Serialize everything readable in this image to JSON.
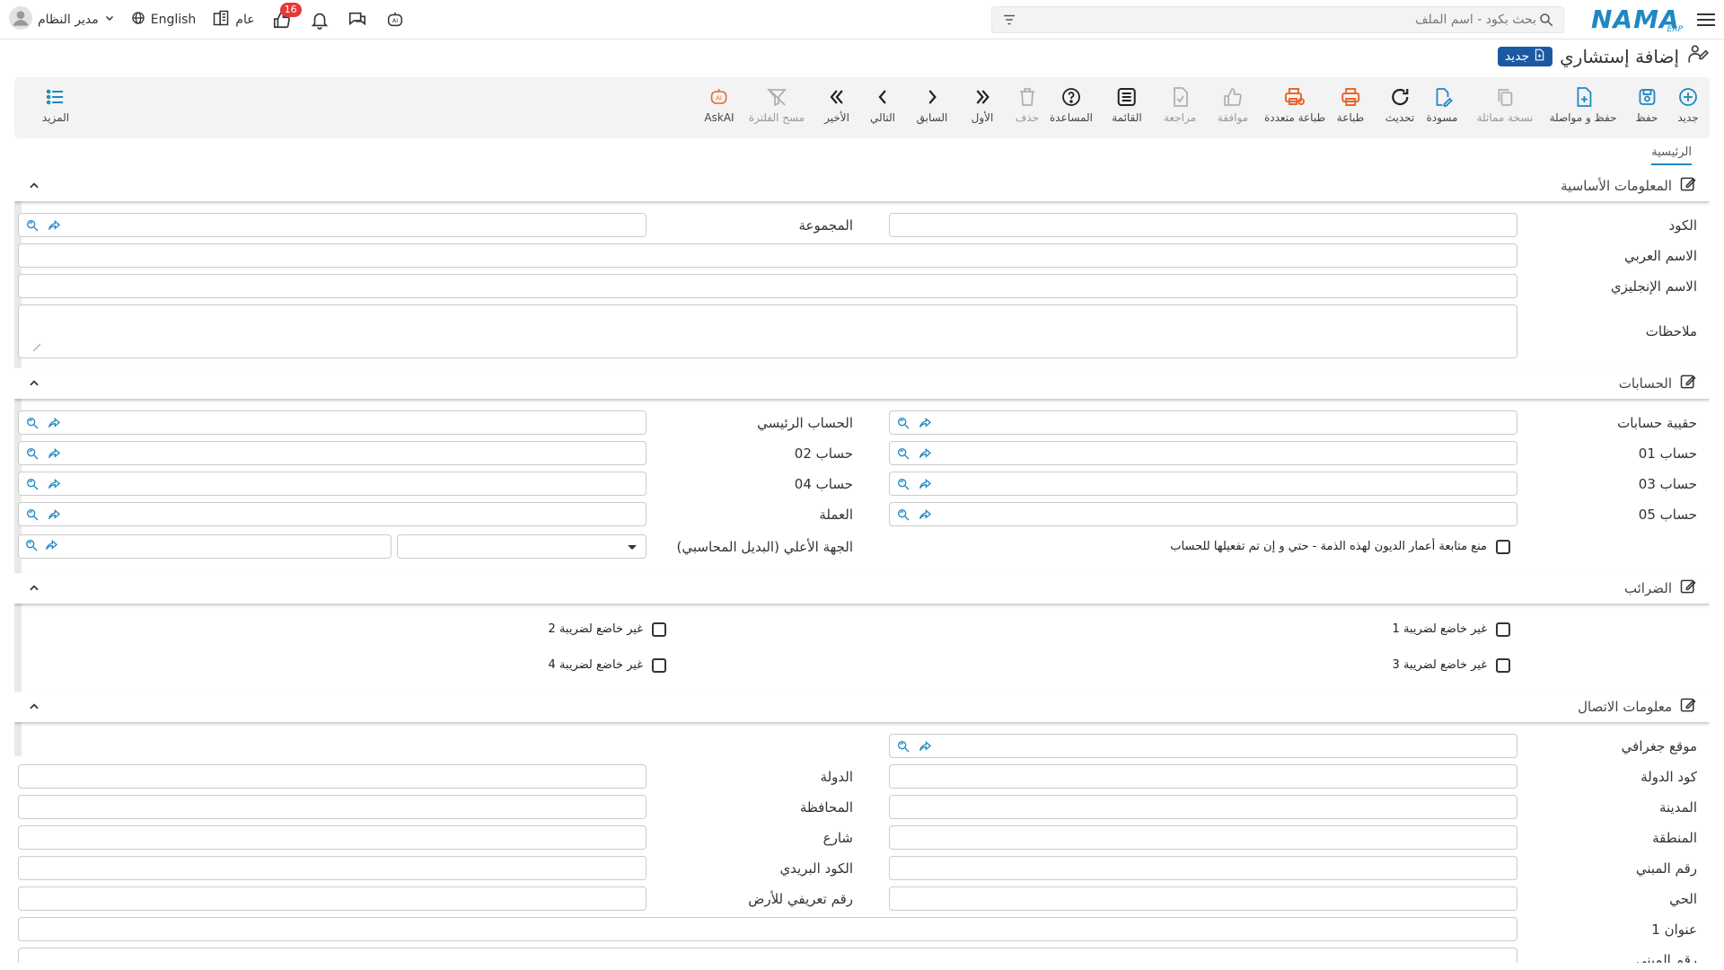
{
  "header": {
    "search_placeholder": "بحث بكود - اسم الملف",
    "logo_text": "NAMA",
    "logo_sub": "ERP",
    "language": "English",
    "user": "مدير النظام",
    "branch": "عام",
    "notification_count": "16"
  },
  "page": {
    "title": "إضافة إستشاري",
    "new_badge": "جديد"
  },
  "toolbar": {
    "new": "جديد",
    "save": "حفظ",
    "save_continue": "حفظ و مواصلة",
    "duplicate": "نسخة مماثلة",
    "draft": "مسودة",
    "refresh": "تحديث",
    "print": "طباعة",
    "multi_print": "طباعة متعددة",
    "approve": "موافقة",
    "review": "مراجعة",
    "list": "القائمة",
    "help": "المساعدة",
    "delete": "حذف",
    "first": "الأول",
    "previous": "السابق",
    "next": "التالي",
    "last": "الأخير",
    "clear_filter": "مسح الفلترة",
    "ask_ai": "AskAI",
    "more": "المزيد"
  },
  "tabs": {
    "main": "الرئيسية"
  },
  "sections": {
    "basic": {
      "title": "المعلومات الأساسية",
      "code": "الكود",
      "group": "المجموعة",
      "arabic_name": "الاسم العربي",
      "english_name": "الاسم الإنجليزي",
      "notes": "ملاحظات"
    },
    "accounts": {
      "title": "الحسابات",
      "account_bag": "حقيبة حسابات",
      "main_account": "الحساب الرئيسي",
      "acc01": "حساب 01",
      "acc02": "حساب 02",
      "acc03": "حساب 03",
      "acc04": "حساب 04",
      "acc05": "حساب 05",
      "currency": "العملة",
      "prevent_aging": "منع متابعة أعمار الديون لهذه الذمة - حتي و إن تم تفعيلها للحساب",
      "parent_entity": "الجهة الأعلي (البديل المحاسبي)"
    },
    "taxes": {
      "title": "الضرائب",
      "tax1": "غير خاضع لضريبة 1",
      "tax2": "غير خاضع لضريبة 2",
      "tax3": "غير خاضع لضريبة 3",
      "tax4": "غير خاضع لضريبة 4"
    },
    "contact": {
      "title": "معلومات الاتصال",
      "geo_location": "موقع جغرافي",
      "country_code": "كود الدولة",
      "country": "الدولة",
      "city": "المدينة",
      "province": "المحافظة",
      "region": "المنطقة",
      "street": "شارع",
      "building_no": "رقم المبني",
      "postal_code": "الكود البريدي",
      "district": "الحي",
      "land_id": "رقم تعريفي للأرض",
      "address1": "عنوان 1",
      "building_no_2": "رقم المبني"
    }
  },
  "colors": {
    "brand": "#1f88c2",
    "badge_blue": "#1b5aa3",
    "print_orange": "#e8682a",
    "notification_red": "#e53935"
  }
}
